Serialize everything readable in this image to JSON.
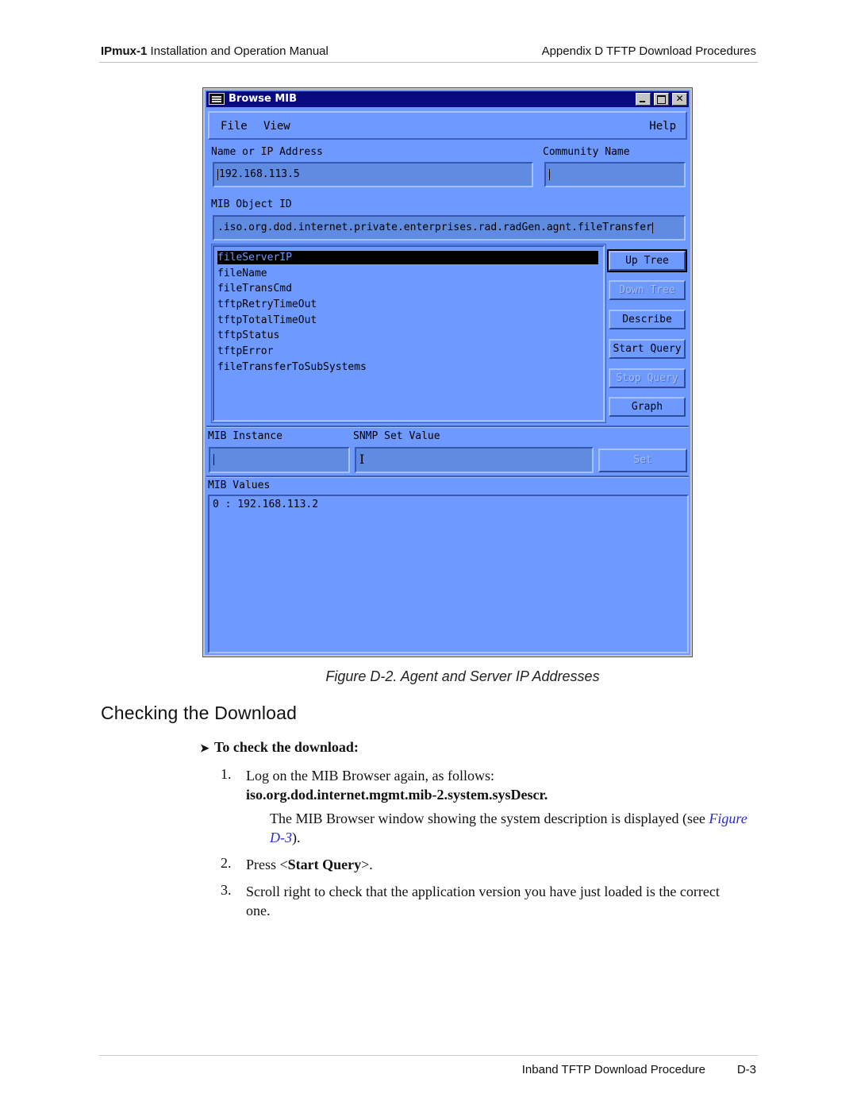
{
  "header": {
    "product": "IPmux-1",
    "manual": "Installation and Operation Manual",
    "section": "Appendix D  TFTP Download Procedures"
  },
  "window": {
    "title": "Browse MIB",
    "menu": {
      "file": "File",
      "view": "View",
      "help": "Help"
    },
    "name_label": "Name or IP Address",
    "name_value": "192.168.113.5",
    "community_label": "Community Name",
    "community_value": "",
    "oid_label": "MIB Object ID",
    "oid_value": ".iso.org.dod.internet.private.enterprises.rad.radGen.agnt.fileTransfer",
    "mib_objects": [
      "fileServerIP",
      "fileName",
      "fileTransCmd",
      "tftpRetryTimeOut",
      "tftpTotalTimeOut",
      "tftpStatus",
      "tftpError",
      "fileTransferToSubSystems"
    ],
    "selected_object": "fileServerIP",
    "buttons": {
      "up_tree": "Up Tree",
      "down_tree": "Down Tree",
      "describe": "Describe",
      "start_query": "Start Query",
      "stop_query": "Stop Query",
      "graph": "Graph",
      "set": "Set"
    },
    "instance_label": "MIB Instance",
    "instance_value": "",
    "snmp_set_label": "SNMP Set Value",
    "snmp_set_value": "",
    "values_label": "MIB Values",
    "values": [
      "0 : 192.168.113.2"
    ]
  },
  "figure_caption": "Figure D-2.  Agent and Server IP Addresses",
  "section_title": "Checking the Download",
  "procedure_title": "To check the download:",
  "steps": {
    "s1_num": "1.",
    "s1_text": "Log on the MIB Browser again, as follows:",
    "s1_oid": "iso.org.dod.internet.mgmt.mib-2.system.sysDescr.",
    "s1_note": "The MIB Browser window showing the system description is displayed (see ",
    "s1_link": "Figure D-3",
    "s1_note_end": ").",
    "s2_num": "2.",
    "s2_pre": "Press <",
    "s2_bold": "Start Query",
    "s2_post": ">.",
    "s3_num": "3.",
    "s3_text": "Scroll right to check that the application version you have just loaded is the correct one."
  },
  "footer": {
    "title": "Inband TFTP Download Procedure",
    "page": "D-3"
  }
}
